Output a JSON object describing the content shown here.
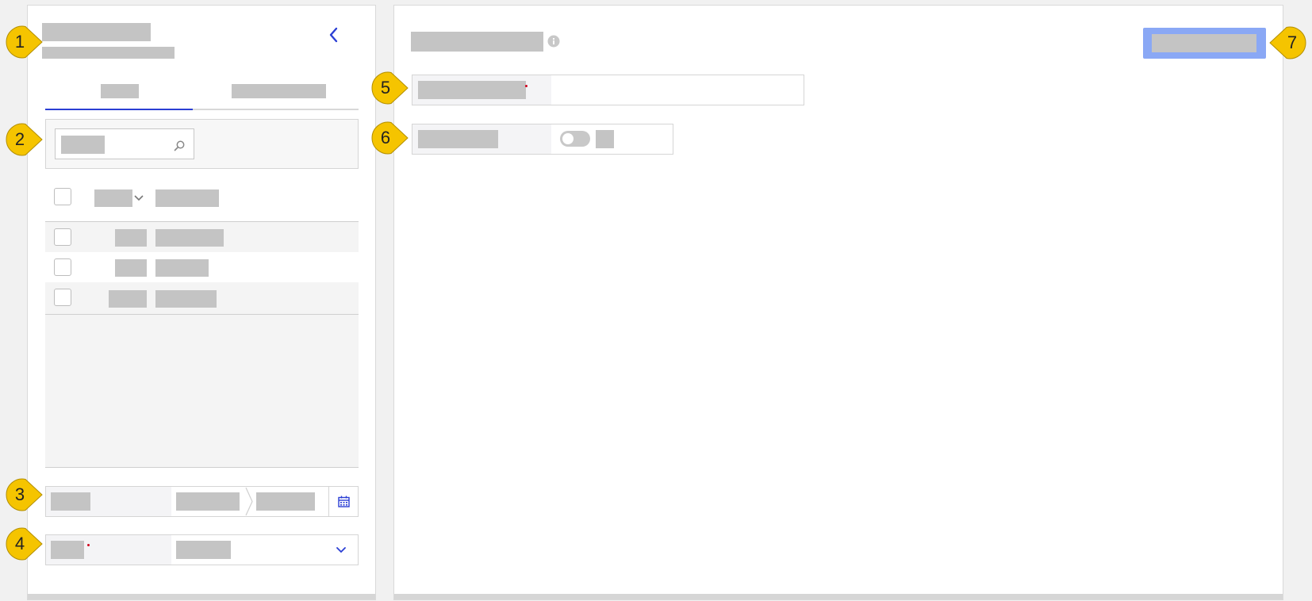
{
  "left_panel": {
    "title": "",
    "subtitle": "",
    "collapse_icon": "chevron-left-icon",
    "tabs": [
      {
        "label": "",
        "active": true
      },
      {
        "label": "",
        "active": false
      }
    ],
    "search": {
      "placeholder": "",
      "icon": "search-icon"
    },
    "table": {
      "headers": [
        "",
        ""
      ],
      "sort_icon": "chevron-down-icon",
      "rows": [
        {
          "col1": "",
          "col2": ""
        },
        {
          "col1": "",
          "col2": ""
        },
        {
          "col1": "",
          "col2": ""
        }
      ]
    },
    "date_range": {
      "label": "",
      "start": "",
      "end": "",
      "icon": "calendar-icon"
    },
    "select": {
      "label": "",
      "value": "",
      "required": true,
      "icon": "chevron-down-icon"
    }
  },
  "right_panel": {
    "title": "",
    "info_icon": "info-icon",
    "primary_button": "",
    "text_field": {
      "label": "",
      "value": "",
      "required": true
    },
    "toggle_field": {
      "label": "",
      "state_label": "",
      "on": false
    }
  },
  "callouts": [
    "1",
    "2",
    "3",
    "4",
    "5",
    "6",
    "7"
  ],
  "colors": {
    "accent": "#2b3fd4",
    "button": "#8aa8f5",
    "callout": "#f5c400",
    "placeholder": "#c4c4c4"
  }
}
